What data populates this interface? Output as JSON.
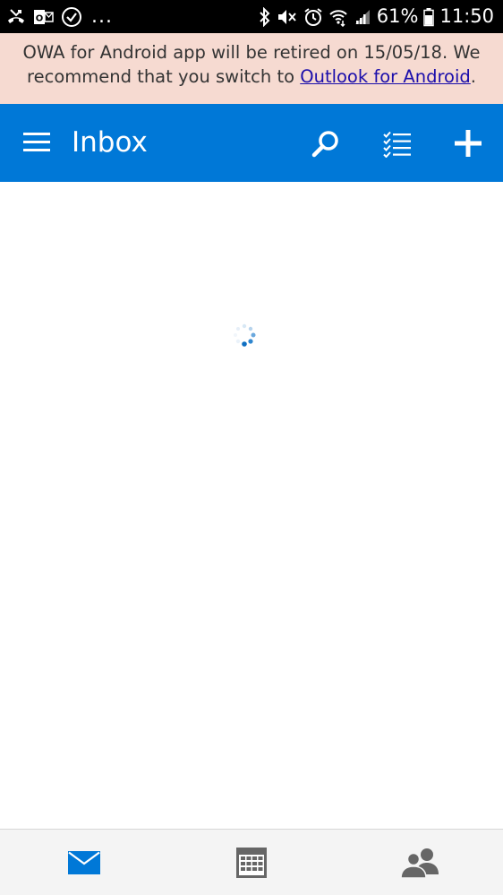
{
  "status_bar": {
    "more_indicator": "...",
    "battery_percent": "61%",
    "time": "11:50",
    "left_icons": [
      "missed-call-icon",
      "outlook-notification-icon",
      "check-circle-icon"
    ],
    "right_icons": [
      "bluetooth-icon",
      "vibrate-mute-icon",
      "alarm-icon",
      "wifi-icon",
      "signal-icon",
      "battery-icon"
    ]
  },
  "banner": {
    "text_before": "OWA for Android app will be retired on 15/05/18. We recommend that you switch to ",
    "link_text": "Outlook for Android",
    "text_after": ".",
    "background": "#f6dad1",
    "link_color": "#1a0dab"
  },
  "header": {
    "title": "Inbox",
    "background": "#0078d7",
    "icons": [
      "hamburger-menu-icon",
      "search-icon",
      "select-list-icon",
      "compose-plus-icon"
    ]
  },
  "content": {
    "loading": true
  },
  "bottom_nav": {
    "items": [
      {
        "name": "mail",
        "icon": "mail-icon",
        "active": true,
        "color": "#0078d7"
      },
      {
        "name": "calendar",
        "icon": "calendar-icon",
        "active": false,
        "color": "#666666"
      },
      {
        "name": "people",
        "icon": "people-icon",
        "active": false,
        "color": "#666666"
      }
    ]
  }
}
